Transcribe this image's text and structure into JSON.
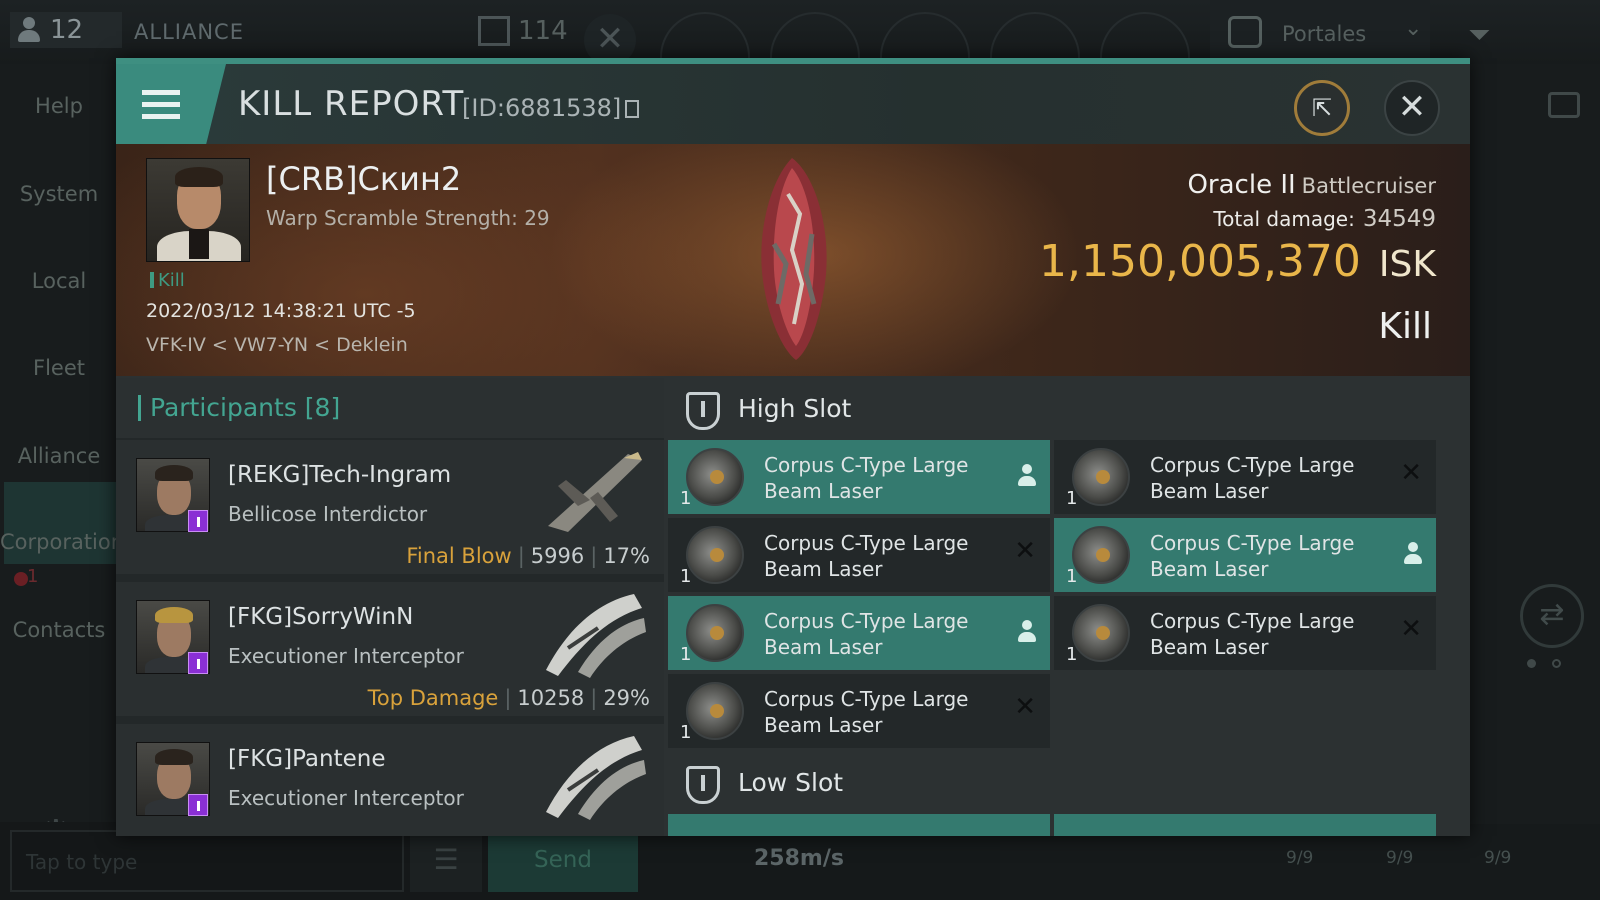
{
  "topbar": {
    "member_count": "12",
    "channel": "ALLIANCE",
    "chat_count": "114",
    "portals_label": "Portales"
  },
  "sidebar": {
    "items": [
      "Help",
      "System",
      "Local",
      "Fleet",
      "Alliance",
      "Corporation",
      "Contacts"
    ],
    "alliance_unread": "1"
  },
  "chat": {
    "input_placeholder": "Tap to type",
    "send_label": "Send"
  },
  "hud": {
    "speed": "258m/s",
    "module_counts": [
      "9/9",
      "9/9",
      "9/9"
    ]
  },
  "report": {
    "title": "KILL REPORT",
    "id": "[ID:6881538]",
    "victim": {
      "name": "[CRB]Скин2",
      "warp": "Warp Scramble Strength: 29",
      "tag": "Kill",
      "date": "2022/03/12 14:38:21 UTC -5",
      "location": "VFK-IV < VW7-YN < Deklein"
    },
    "ship": {
      "name": "Oracle II",
      "class": "Battlecruiser",
      "damage_label": "Total damage:",
      "damage": "34549",
      "isk_value": "1,150,005,370",
      "isk_unit": "ISK",
      "status": "Kill"
    },
    "participants": {
      "title": "Participants [8]",
      "rows": [
        {
          "name": "[REKG]Tech-Ingram",
          "ship": "Bellicose Interdictor",
          "tag": "Final Blow",
          "damage": "5996",
          "percent": "17%"
        },
        {
          "name": "[FKG]SorryWinN",
          "ship": "Executioner Interceptor",
          "tag": "Top Damage",
          "damage": "10258",
          "percent": "29%"
        },
        {
          "name": "[FKG]Pantene",
          "ship": "Executioner Interceptor"
        }
      ]
    },
    "fitting": {
      "high_slot_label": "High Slot",
      "low_slot_label": "Low Slot",
      "high_slot": [
        {
          "name": "Corpus C-Type Large Beam Laser",
          "qty": "1",
          "status": "dropped"
        },
        {
          "name": "Corpus C-Type Large Beam Laser",
          "qty": "1",
          "status": "destroyed"
        },
        {
          "name": "Corpus C-Type Large Beam Laser",
          "qty": "1",
          "status": "destroyed"
        },
        {
          "name": "Corpus C-Type Large Beam Laser",
          "qty": "1",
          "status": "dropped"
        },
        {
          "name": "Corpus C-Type Large Beam Laser",
          "qty": "1",
          "status": "dropped"
        },
        {
          "name": "Corpus C-Type Large Beam Laser",
          "qty": "1",
          "status": "destroyed"
        },
        {
          "name": "Corpus C-Type Large Beam Laser",
          "qty": "1",
          "status": "destroyed"
        }
      ]
    }
  },
  "colors": {
    "accent": "#3e8f81",
    "isk": "#e9b64a",
    "tag_gold": "#d9a23b",
    "dropped_bg": "#347a6f"
  }
}
